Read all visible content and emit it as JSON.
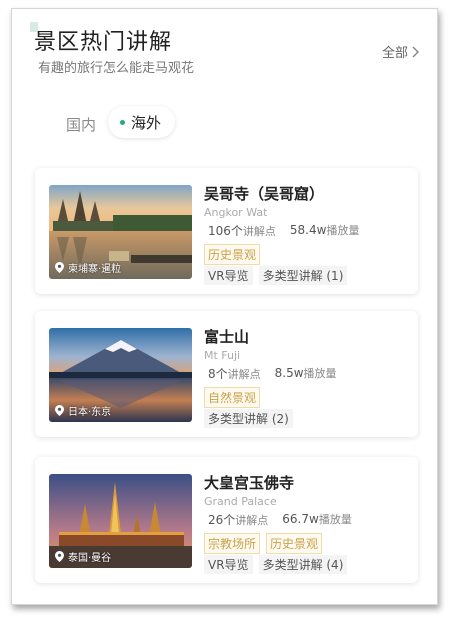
{
  "header": {
    "title": "景区热门讲解",
    "subtitle": "有趣的旅行怎么能走马观花",
    "all_label": "全部"
  },
  "tabs": [
    {
      "label": "国内",
      "active": false
    },
    {
      "label": "海外",
      "active": true
    }
  ],
  "cards": [
    {
      "name": "吴哥寺（吴哥窟）",
      "en_name": "Angkor Wat",
      "points": "106个",
      "points_unit": "讲解点",
      "plays": "58.4w",
      "plays_unit": "播放量",
      "location": "柬埔寨·暹粒",
      "tags": [
        "历史景观"
      ],
      "features": [
        "VR导览",
        "多类型讲解 (1)"
      ]
    },
    {
      "name": "富士山",
      "en_name": "Mt Fuji",
      "points": "8个",
      "points_unit": "讲解点",
      "plays": "8.5w",
      "plays_unit": "播放量",
      "location": "日本·东京",
      "tags": [
        "自然景观"
      ],
      "features": [
        "多类型讲解 (2)"
      ]
    },
    {
      "name": "大皇宫玉佛寺",
      "en_name": "Grand Palace",
      "points": "26个",
      "points_unit": "讲解点",
      "plays": "66.7w",
      "plays_unit": "播放量",
      "location": "泰国·曼谷",
      "tags": [
        "宗教场所",
        "历史景观"
      ],
      "features": [
        "VR导览",
        "多类型讲解 (4)"
      ]
    }
  ],
  "colors": {
    "accent": "#1fae7a",
    "tag_text": "#c9a24a"
  }
}
